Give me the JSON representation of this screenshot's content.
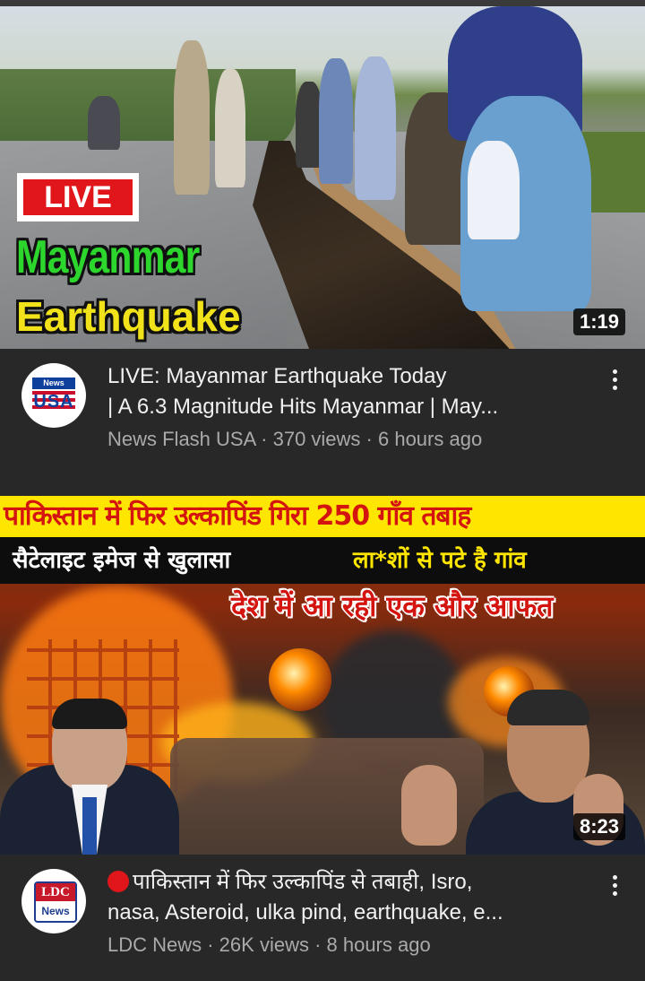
{
  "video1": {
    "thumbnail": {
      "badge": "LIVE",
      "title_line1": "Mayanmar",
      "title_line2": "Earthquake",
      "duration": "1:19"
    },
    "title_line1": "LIVE: Mayanmar Earthquake Today",
    "title_line2": "| A 6.3 Magnitude Hits Mayanmar | May...",
    "channel": "News Flash USA",
    "views": "370 views",
    "age": "6 hours ago",
    "subline": "News Flash USA · 370 views · 6 hours ago",
    "avatar": {
      "top_text": "News Flash",
      "main_text": "USA"
    }
  },
  "video2": {
    "thumbnail": {
      "line1": "पाकिस्तान में फिर उल्कापिंड गिरा 250 गाँव तबाह",
      "line2a": "सैटेलाइट इमेज से खुलासा",
      "line2b": "ला*शों से पटे है गांव",
      "line3": "देश में आ रही एक और आफत",
      "duration": "8:23"
    },
    "live_dot_icon": "red-circle-icon",
    "title_line1": "पाकिस्तान में फिर उल्कापिंड से तबाही, Isro,",
    "title_line2": "nasa, Asteroid, ulka pind, earthquake, e...",
    "channel": "LDC News",
    "views": "26K views",
    "age": "8 hours ago",
    "subline": "LDC News · 26K views · 8 hours ago",
    "avatar": {
      "top_text": "LDC",
      "bottom_text": "News"
    }
  },
  "colors": {
    "background": "#282828",
    "live_red": "#e0161b",
    "title_green": "#2dd62d",
    "title_yellow": "#f2e21a",
    "secondary_text": "#aaaaaa"
  }
}
